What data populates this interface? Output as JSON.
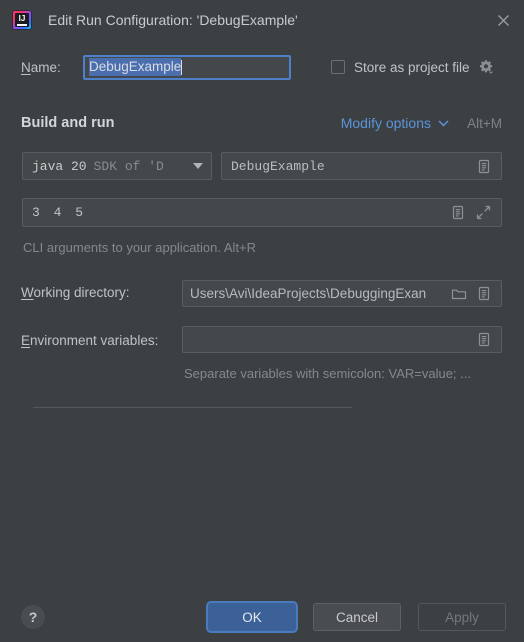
{
  "window": {
    "title": "Edit Run Configuration: 'DebugExample'",
    "app_icon": "intellij-idea-icon",
    "close_icon": "close-icon"
  },
  "name_row": {
    "label": "Name:",
    "mnemonic": "N",
    "value": "DebugExample",
    "selected": true
  },
  "store_as_project_file": {
    "label": "Store as project file",
    "checked": false,
    "gear_icon": "gear-icon"
  },
  "build_and_run": {
    "heading": "Build and run",
    "modify_options_label": "Modify options",
    "modify_options_shortcut": "Alt+M",
    "jdk": {
      "name": "java 20",
      "detail": "SDK of 'D",
      "dropdown_icon": "chevron-down-icon"
    },
    "main_class": {
      "value": "DebugExample",
      "browse_icon": "list-icon"
    },
    "program_arguments": {
      "value": "3 4 5",
      "list_icon": "list-icon",
      "expand_icon": "expand-icon",
      "hint": "CLI arguments to your application. Alt+R"
    }
  },
  "working_directory": {
    "label": "Working directory:",
    "mnemonic": "W",
    "value": "Users\\Avi\\IdeaProjects\\DebuggingExan",
    "folder_icon": "folder-icon",
    "list_icon": "list-icon"
  },
  "environment_variables": {
    "label": "Environment variables:",
    "mnemonic": "E",
    "value": "",
    "list_icon": "list-icon",
    "hint": "Separate variables with semicolon: VAR=value; ..."
  },
  "footer": {
    "help_label": "?",
    "ok_label": "OK",
    "cancel_label": "Cancel",
    "apply_label": "Apply",
    "apply_enabled": false
  },
  "colors": {
    "dialog_background": "#3c4043",
    "field_background": "#45484a",
    "field_border": "#5a5d5f",
    "focus_border": "#4d7fcb",
    "selection_background": "#4b6eaf",
    "link_blue": "#5b93d8",
    "ok_button": "#3c6098",
    "text_primary": "#bfc3c7",
    "text_muted": "#85898d"
  }
}
